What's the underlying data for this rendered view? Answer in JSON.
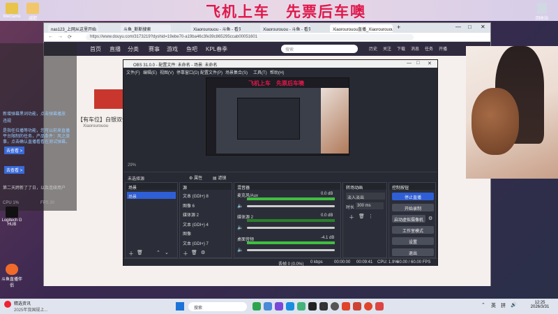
{
  "banner": {
    "text": "飞机上车　先票后车噢"
  },
  "desktop_icons": [
    {
      "label": "WeGame",
      "color": "#e8c44a"
    },
    {
      "label": "减肥",
      "color": "#f2c66b"
    }
  ],
  "desktop_bottom_icons": [
    {
      "label": "Logitech G HUB"
    },
    {
      "label": "斗鱼直播伴侣"
    }
  ],
  "recycle": {
    "label": "回收站"
  },
  "browser": {
    "tabs": [
      {
        "label": "nas123_上网从这里开始"
      },
      {
        "label": "斗鱼_斯斯搜索"
      },
      {
        "label": "Xiaorourouou - 斗鱼 - 看见每种热爱"
      },
      {
        "label": "Xiaorourouou - 斗鱼 - 看见每种热爱"
      },
      {
        "label": "Xiaorourouou直播_Xiaorourouou..."
      }
    ],
    "url": "https://www.douyu.com/3173219?dyshid=19ebe70-a19ba46c3fe39c865295ccab00051601",
    "nav": [
      "首页",
      "直播",
      "分类",
      "赛事",
      "游戏",
      "鱼吧",
      "KPL春季"
    ],
    "search_placeholder": "搜索",
    "right_nav": [
      "历史",
      "关注",
      "下载",
      "消息",
      "任务",
      "开播"
    ],
    "stream_title": "【有车位】白银双倍噢",
    "streamer": "Xiaorourouou"
  },
  "left_panel": {
    "lines": [
      "新增弹幕黑词功能，点击弹幕播放",
      "违规",
      "是指任拉播等功能，您可以前来直播",
      "平台限制的任务，产品条件：风之旅",
      "事，点击确认直播看看在测试弹幕。",
      "去查看 >",
      "去查看 >",
      "第二天跨新了了日，以及连续用户"
    ],
    "cpu": "CPU 1%",
    "fps": "FPS 30"
  },
  "obs": {
    "title": "OBS 31.0.0 - 配置文件: 未命名 - 场景: 未命名",
    "menu": [
      "文件(F)",
      "编辑(E)",
      "视图(V)",
      "停靠窗口(D)",
      "配置文件(P)",
      "场景集合(S)",
      "工具(T)",
      "帮助(H)"
    ],
    "preview_banner": "飞机上车　先票后车噢",
    "zoom": "29%",
    "no_source": "未选择源",
    "props_btn": "属性",
    "filters_btn": "滤镜",
    "docks": {
      "scenes": {
        "title": "场景",
        "items": [
          "场景"
        ]
      },
      "sources": {
        "title": "源",
        "items": [
          "文本 (GDI+) 8",
          "图像 6",
          "媒体源 2",
          "文本 (GDI+) 4",
          "图像",
          "文本 (GDI+) 7"
        ]
      },
      "mixer": {
        "title": "混音器",
        "channels": [
          {
            "name": "麦克风/Aux",
            "db": "0.0 dB"
          },
          {
            "name": "媒体源 2",
            "db": "0.0 dB"
          },
          {
            "name": "桌面音频",
            "db": "-4.1 dB"
          }
        ]
      },
      "transitions": {
        "title": "转场动画",
        "type": "淡入淡出",
        "duration_label": "时长",
        "duration": "300 ms"
      },
      "controls": {
        "title": "控制按钮",
        "buttons": [
          "停止直播",
          "开始录制",
          "启动虚拟摄像机",
          "工作室模式",
          "设置",
          "退出"
        ]
      }
    },
    "status": {
      "dropped": "丢帧 0 (0.0%)",
      "kbps": "0 kbps",
      "rec_time": "00:00:00",
      "stream_time": "00:09:41",
      "cpu": "CPU: 1.9%",
      "fps": "60.00 / 60.00 FPS"
    }
  },
  "taskbar": {
    "news_title": "精选资讯",
    "news_sub": "2025年我国规上...",
    "search_placeholder": "搜索",
    "lang": "英",
    "ime": "拼",
    "time": "12:25",
    "date": "2026/3/31"
  },
  "colors": {
    "banner_text": "#e0184b",
    "obs_bg": "#272a33",
    "stop_stream": "#2f5fd6",
    "meter_green": "#3fbf3f"
  }
}
